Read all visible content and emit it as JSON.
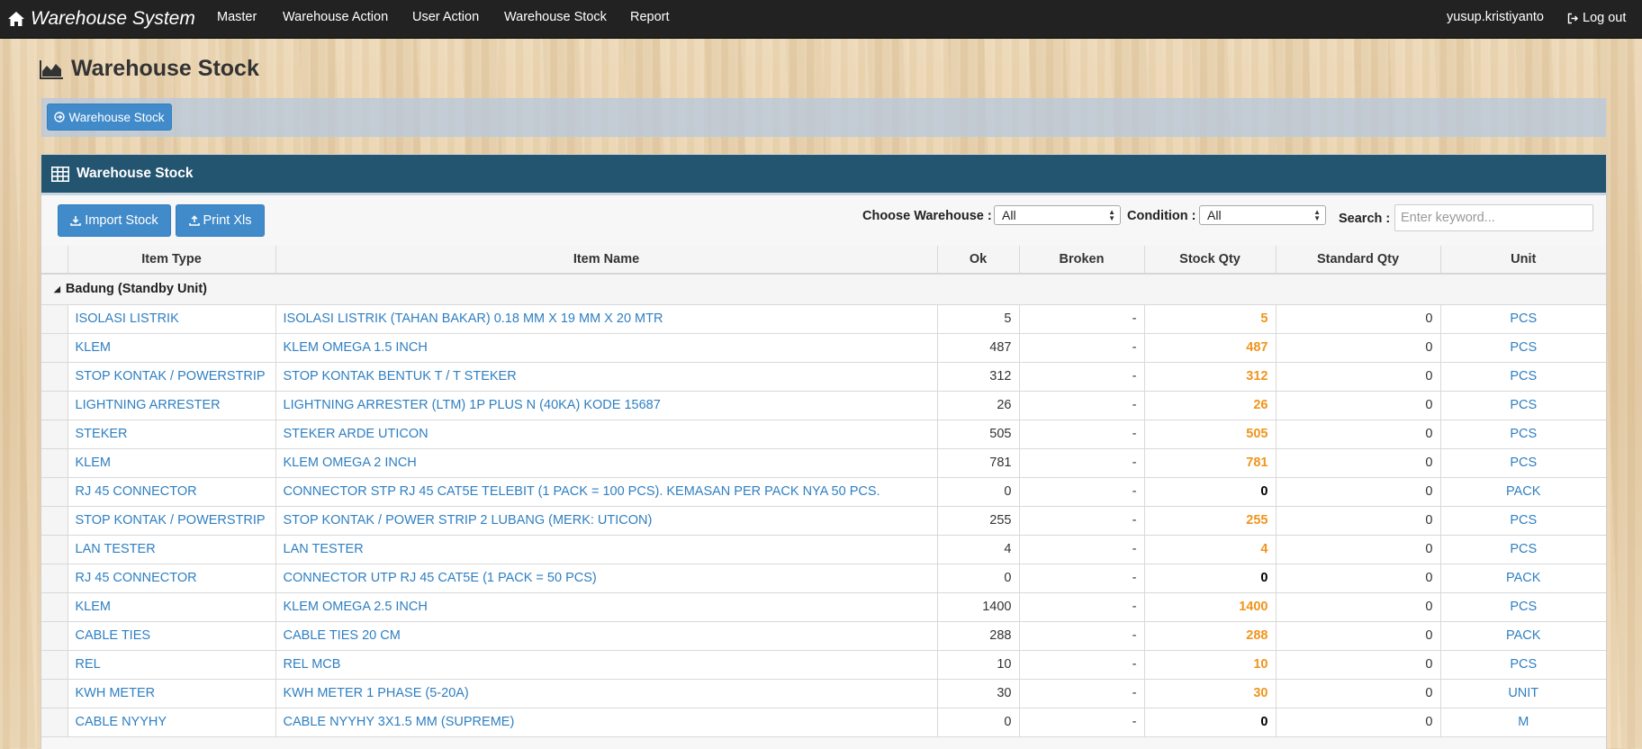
{
  "navbar": {
    "brand": "Warehouse System",
    "items": [
      "Master",
      "Warehouse Action",
      "User Action",
      "Warehouse Stock",
      "Report"
    ],
    "user": "yusup.kristiyanto",
    "logout": "Log out"
  },
  "page": {
    "title": "Warehouse Stock",
    "breadcrumb_button": "Warehouse Stock"
  },
  "panel": {
    "title": "Warehouse Stock",
    "import_button": "Import Stock",
    "print_button": "Print Xls",
    "warehouse_label": "Choose Warehouse :",
    "warehouse_value": "All",
    "condition_label": "Condition :",
    "condition_value": "All",
    "search_label": "Search :",
    "search_placeholder": "Enter keyword..."
  },
  "table": {
    "columns": [
      "Item Type",
      "Item Name",
      "Ok",
      "Broken",
      "Stock Qty",
      "Standard Qty",
      "Unit"
    ],
    "group": "Badung (Standby Unit)",
    "rows": [
      {
        "type": "ISOLASI LISTRIK",
        "name": "ISOLASI LISTRIK (TAHAN BAKAR) 0.18 MM X 19 MM X 20 MTR",
        "ok": "5",
        "broken": "-",
        "stock": "5",
        "standard": "0",
        "unit": "PCS"
      },
      {
        "type": "KLEM",
        "name": "KLEM OMEGA 1.5 INCH",
        "ok": "487",
        "broken": "-",
        "stock": "487",
        "standard": "0",
        "unit": "PCS"
      },
      {
        "type": "STOP KONTAK / POWERSTRIP",
        "name": "STOP KONTAK BENTUK T / T STEKER",
        "ok": "312",
        "broken": "-",
        "stock": "312",
        "standard": "0",
        "unit": "PCS"
      },
      {
        "type": "LIGHTNING ARRESTER",
        "name": "LIGHTNING ARRESTER (LTM) 1P PLUS N (40KA) KODE 15687",
        "ok": "26",
        "broken": "-",
        "stock": "26",
        "standard": "0",
        "unit": "PCS"
      },
      {
        "type": "STEKER",
        "name": "STEKER ARDE UTICON",
        "ok": "505",
        "broken": "-",
        "stock": "505",
        "standard": "0",
        "unit": "PCS"
      },
      {
        "type": "KLEM",
        "name": "KLEM OMEGA 2 INCH",
        "ok": "781",
        "broken": "-",
        "stock": "781",
        "standard": "0",
        "unit": "PCS"
      },
      {
        "type": "RJ 45 CONNECTOR",
        "name": "CONNECTOR STP RJ 45 CAT5E TELEBIT (1 PACK = 100 PCS). KEMASAN PER PACK NYA 50 PCS.",
        "ok": "0",
        "broken": "-",
        "stock": "0",
        "standard": "0",
        "unit": "PACK"
      },
      {
        "type": "STOP KONTAK / POWERSTRIP",
        "name": "STOP KONTAK / POWER STRIP 2 LUBANG (MERK: UTICON)",
        "ok": "255",
        "broken": "-",
        "stock": "255",
        "standard": "0",
        "unit": "PCS"
      },
      {
        "type": "LAN TESTER",
        "name": "LAN TESTER",
        "ok": "4",
        "broken": "-",
        "stock": "4",
        "standard": "0",
        "unit": "PCS"
      },
      {
        "type": "RJ 45 CONNECTOR",
        "name": "CONNECTOR UTP RJ 45 CAT5E (1 PACK = 50 PCS)",
        "ok": "0",
        "broken": "-",
        "stock": "0",
        "standard": "0",
        "unit": "PACK"
      },
      {
        "type": "KLEM",
        "name": "KLEM OMEGA 2.5 INCH",
        "ok": "1400",
        "broken": "-",
        "stock": "1400",
        "standard": "0",
        "unit": "PCS"
      },
      {
        "type": "CABLE TIES",
        "name": "CABLE TIES 20 CM",
        "ok": "288",
        "broken": "-",
        "stock": "288",
        "standard": "0",
        "unit": "PACK"
      },
      {
        "type": "REL",
        "name": "REL MCB",
        "ok": "10",
        "broken": "-",
        "stock": "10",
        "standard": "0",
        "unit": "PCS"
      },
      {
        "type": "KWH METER",
        "name": "KWH METER 1 PHASE (5-20A)",
        "ok": "30",
        "broken": "-",
        "stock": "30",
        "standard": "0",
        "unit": "UNIT"
      },
      {
        "type": "CABLE NYYHY",
        "name": "CABLE NYYHY 3X1.5 MM (SUPREME)",
        "ok": "0",
        "broken": "-",
        "stock": "0",
        "standard": "0",
        "unit": "M"
      }
    ]
  },
  "colors": {
    "navbar": "#222222",
    "panel_header": "#235470",
    "button": "#428bca",
    "link": "#2f7fc1",
    "stock_positive": "#f0941d"
  }
}
